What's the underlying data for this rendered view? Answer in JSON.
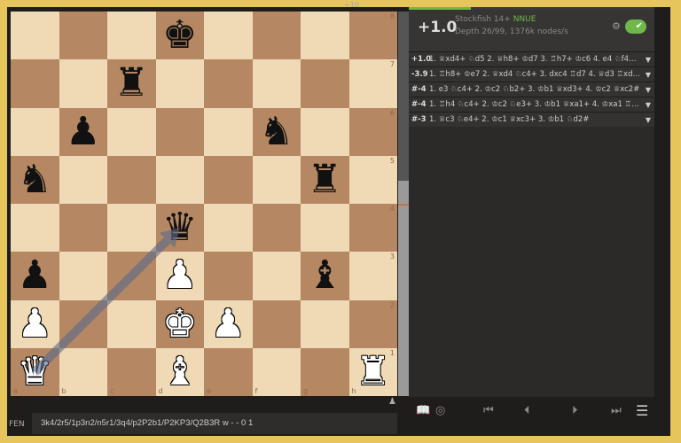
{
  "board": {
    "fen_position": "3k4/2r5/1p3n2/n5r1/3q4/p2P2b1/P2KP3/Q2B3R",
    "files": [
      "a",
      "b",
      "c",
      "d",
      "e",
      "f",
      "g",
      "h"
    ],
    "ranks": [
      "8",
      "7",
      "6",
      "5",
      "4",
      "3",
      "2",
      "1"
    ],
    "colors": {
      "light": "#f0d9b5",
      "dark": "#b58863"
    },
    "arrow": {
      "from": "a1",
      "to": "d4",
      "color": "#5a6a8a"
    }
  },
  "eval_bar": {
    "white_fraction": 0.56
  },
  "top_info": "+10",
  "engine": {
    "score": "+1.0",
    "name": "Stockfish 14+",
    "nnue": "NNUE",
    "depth": "Depth 26/99, 1376k nodes/s",
    "lines": [
      {
        "score": "+1.0",
        "moves": "1. ♕xd4+ ♘d5 2. ♕h8+ ♔d7 3. ♖h7+ ♔c6 4. e4 ♘f4+ 5. ♔..."
      },
      {
        "score": "-3.9",
        "moves": "1. ♖h8+ ♔e7 2. ♕xd4 ♘c4+ 3. dxc4 ♖d7 4. ♕d3 ♖xd3+ 5...."
      },
      {
        "score": "#-4",
        "moves": "1. e3 ♘c4+ 2. ♔c2 ♘b2+ 3. ♔b1 ♕xd3+ 4. ♔c2 ♕xc2#"
      },
      {
        "score": "#-4",
        "moves": "1. ♖h4 ♘c4+ 2. ♔c2 ♘e3+ 3. ♔b1 ♕xa1+ 4. ♔xa1 ♖c1#"
      },
      {
        "score": "#-3",
        "moves": "1. ♕c3 ♘e4+ 2. ♔c1 ♕xc3+ 3. ♔b1 ♘d2#"
      }
    ]
  },
  "fen": {
    "label": "FEN",
    "value": "3k4/2r5/1p3n2/n5r1/3q4/p2P2b1/P2KP3/Q2B3R w - - 0 1"
  },
  "accent": "#6fb84a"
}
